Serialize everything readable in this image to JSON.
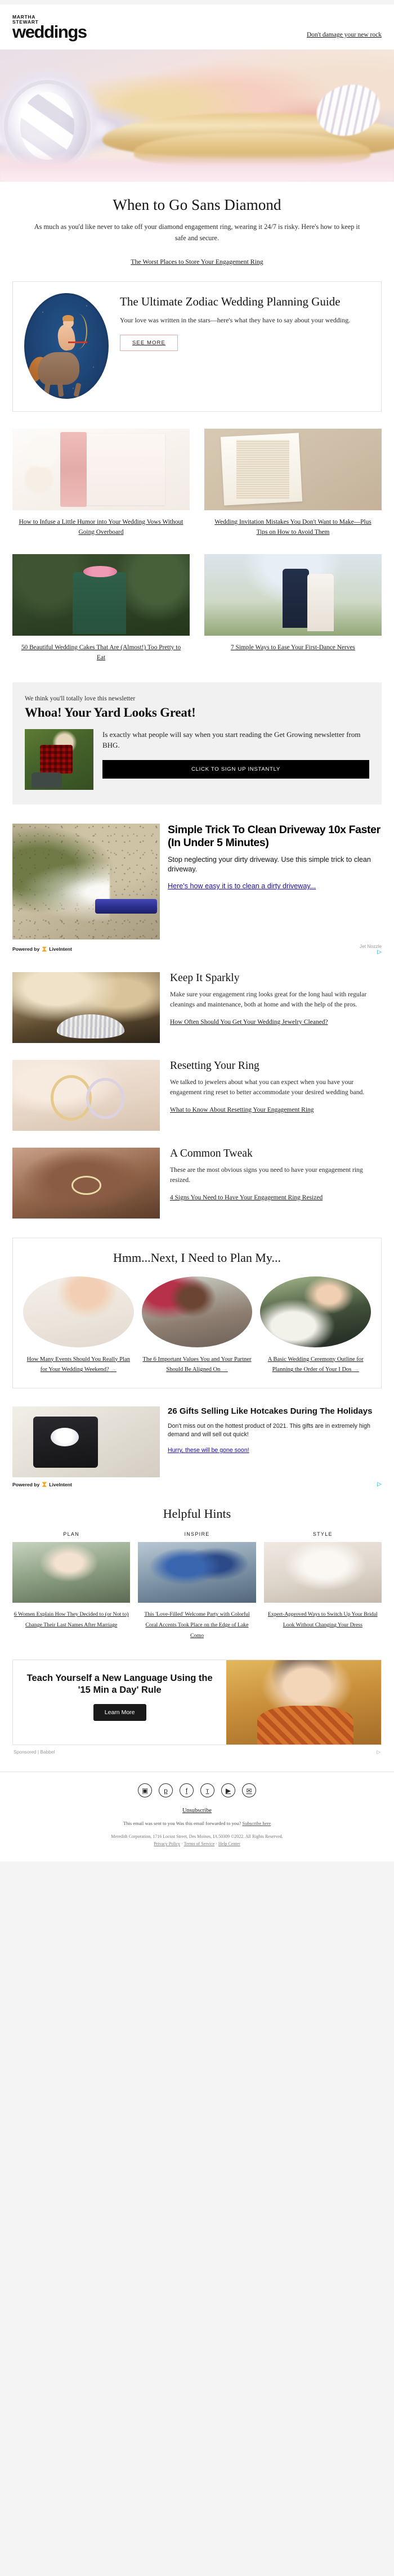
{
  "header": {
    "logo_line1": "MARTHA",
    "logo_line2": "STEWART",
    "logo_word": "weddings",
    "preheader": "Don't damage your new rock"
  },
  "lead": {
    "title": "When to Go Sans Diamond",
    "dek": "As much as you'd like never to take off your diamond engagement ring, wearing it 24/7 is risky. Here's how to keep it safe and secure.",
    "link": "The Worst Places to Store Your Engagement Ring"
  },
  "zodiac_promo": {
    "title": "The Ultimate Zodiac Wedding Planning Guide",
    "body": "Your love was written in the stars—here's what they have to say about your wedding.",
    "cta": "SEE MORE"
  },
  "cards": [
    {
      "caption": "How to Infuse a Little Humor into Your Wedding Vows Without Going Overboard"
    },
    {
      "caption": "Wedding Invitation Mistakes You Don't Want to Make—Plus Tips on How to Avoid Them"
    },
    {
      "caption": "50 Beautiful Wedding Cakes That Are (Almost!) Too Pretty to Eat"
    },
    {
      "caption": "7 Simple Ways to Ease Your First-Dance Nerves"
    }
  ],
  "bhg": {
    "kicker": "We think you'll totally love this newsletter",
    "title": "Whoa! Your Yard Looks Great!",
    "body": "Is exactly what people will say when you start reading the Get Growing newsletter from BHG.",
    "button": "CLICK TO SIGN UP INSTANTLY"
  },
  "driveway_ad": {
    "title": "Simple Trick To Clean Driveway 10x Faster (In Under 5 Minutes)",
    "body": "Stop neglecting your dirty driveway. Use this simple trick to clean driveway.",
    "link": "Here's how easy it is to clean a dirty driveway...",
    "powered_by": "Powered by",
    "network": "LiveIntent",
    "advertiser": "Jet Nozzle"
  },
  "articles": [
    {
      "title": "Keep It Sparkly",
      "body": "Make sure your engagement ring looks great for the long haul with regular cleanings and maintenance, both at home and with the help of the pros.",
      "link": "How Often Should You Get Your Wedding Jewelry Cleaned?"
    },
    {
      "title": "Resetting Your Ring",
      "body": "We talked to jewelers about what you can expect when you have your engagement ring reset to better accommodate your desired wedding band.",
      "link": "What to Know About Resetting Your Engagement Ring"
    },
    {
      "title": "A Common Tweak",
      "body": "These are the most obvious signs you need to have your engagement ring resized.",
      "link": "4 Signs You Need to Have Your Engagement Ring Resized"
    }
  ],
  "plan": {
    "title": "Hmm...Next, I Need to Plan My...",
    "items": [
      {
        "link": "How Many Events Should You Really Plan for Your Wedding Weekend?",
        "arrow": "→"
      },
      {
        "link": "The 6 Important Values You and Your Partner Should Be Aligned On",
        "arrow": "→"
      },
      {
        "link": "A Basic Wedding Ceremony Outline for Planning the Order of Your I Dos",
        "arrow": "→"
      }
    ]
  },
  "gift_ad": {
    "title": "26 Gifts Selling Like Hotcakes During The Holidays",
    "body": "Don't miss out on the hottest product of 2021. This gifts are in extremely high demand and will sell out quick!",
    "link": "Hurry, these will be gone soon!",
    "powered_by": "Powered by",
    "network": "LiveIntent"
  },
  "hints": {
    "title": "Helpful Hints",
    "columns": [
      {
        "label": "PLAN",
        "link": "6 Women Explain How They Decided to (or Not to) Change Their Last Names After Marriage"
      },
      {
        "label": "INSPIRE",
        "link": "This 'Love-Filled' Welcome Party with Colorful Coral Accents Took Place on the Edge of Lake Como"
      },
      {
        "label": "STYLE",
        "link": "Expert-Approved Ways to Switch Up Your Bridal Look Without Changing Your Dress"
      }
    ]
  },
  "lang_ad": {
    "title": "Teach Yourself a New Language Using the '15 Min a Day' Rule",
    "button": "Learn More",
    "sponsored": "Sponsored | Babbel"
  },
  "footer": {
    "social": [
      {
        "name": "instagram-icon",
        "glyph": "▣"
      },
      {
        "name": "pinterest-icon",
        "glyph": "р"
      },
      {
        "name": "facebook-icon",
        "glyph": "f"
      },
      {
        "name": "twitter-icon",
        "glyph": "ᴛ"
      },
      {
        "name": "youtube-icon",
        "glyph": "▶"
      },
      {
        "name": "email-icon",
        "glyph": "✉"
      }
    ],
    "unsubscribe": "Unsubscribe",
    "forward_prefix": "This email was sent to you",
    "forward_mid": "Was this email forwarded to you?",
    "forward_link": "Subscribe here",
    "copyright": "Meredith Corporation, 1716 Locust Street, Des Moines, IA 50309 ©2022. All Rights Reserved.",
    "links": [
      {
        "label": "Privacy Policy"
      },
      {
        "label": "Terms of Service"
      },
      {
        "label": "Help Center"
      }
    ]
  }
}
